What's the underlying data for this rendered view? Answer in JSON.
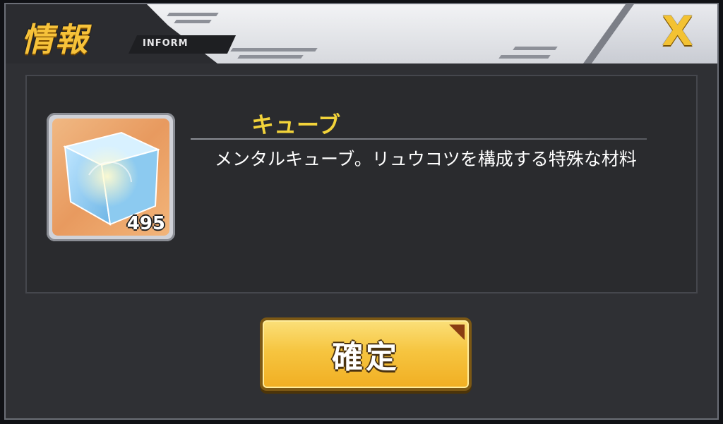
{
  "dialog": {
    "title": "情報",
    "subtitle": "INFORM",
    "close_label": "X",
    "confirm_label": "確定"
  },
  "item": {
    "name": "キューブ",
    "count": "495",
    "description": "メンタルキューブ。リュウコツを構成する特殊な材料",
    "icon": "mental-cube-icon"
  },
  "colors": {
    "accent_gold": "#f6c540",
    "title_gold": "#f6c23a",
    "item_name_yellow": "#f2d33a",
    "panel_dark": "#2a2b2e"
  }
}
